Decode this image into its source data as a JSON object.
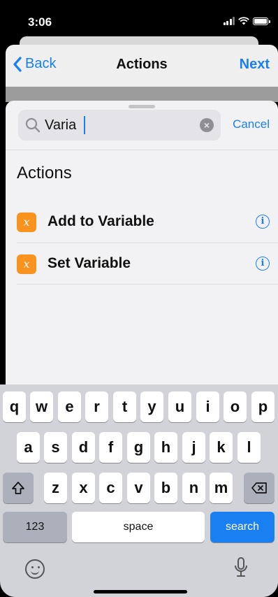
{
  "status_bar": {
    "time": "3:06"
  },
  "nav": {
    "back_label": "Back",
    "title": "Actions",
    "next_label": "Next"
  },
  "search": {
    "value": "Varia",
    "cancel_label": "Cancel"
  },
  "section": {
    "title": "Actions"
  },
  "actions": [
    {
      "icon": "x",
      "label": "Add to Variable",
      "info": "i"
    },
    {
      "icon": "x",
      "label": "Set Variable",
      "info": "i"
    }
  ],
  "keyboard": {
    "row1": [
      "q",
      "w",
      "e",
      "r",
      "t",
      "y",
      "u",
      "i",
      "o",
      "p"
    ],
    "row2": [
      "a",
      "s",
      "d",
      "f",
      "g",
      "h",
      "j",
      "k",
      "l"
    ],
    "row3": [
      "z",
      "x",
      "c",
      "v",
      "b",
      "n",
      "m"
    ],
    "numbers_label": "123",
    "space_label": "space",
    "search_label": "search"
  },
  "colors": {
    "accent": "#1a7ff0",
    "action_badge": "#f7931e"
  }
}
